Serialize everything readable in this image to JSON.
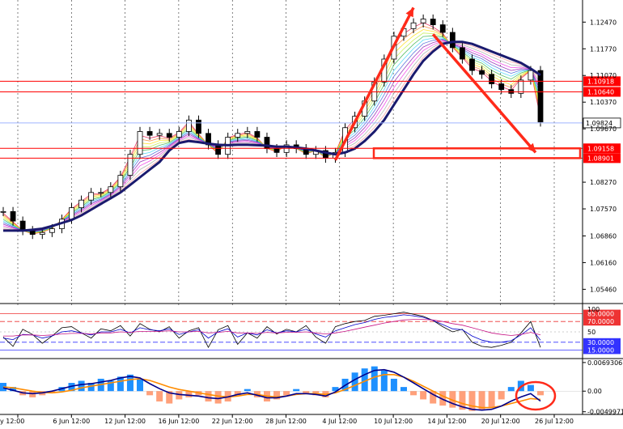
{
  "chart_data": {
    "type": "candlestick",
    "main": {
      "ylim": [
        1.0515,
        1.1305
      ],
      "y_ticks": [
        {
          "v": 1.1247,
          "label": "1.12470"
        },
        {
          "v": 1.1177,
          "label": "1.11770"
        },
        {
          "v": 1.1107,
          "label": "1.11070"
        },
        {
          "v": 1.1037,
          "label": "1.10370"
        },
        {
          "v": 1.0967,
          "label": "1.09670"
        },
        {
          "v": 1.0827,
          "label": "1.08270"
        },
        {
          "v": 1.0757,
          "label": "1.07570"
        },
        {
          "v": 1.0686,
          "label": "1.06860"
        },
        {
          "v": 1.0616,
          "label": "1.06160"
        },
        {
          "v": 1.0546,
          "label": "1.05460"
        }
      ],
      "levels": [
        {
          "v": 1.10918,
          "label": "1.10918",
          "type": "resistance"
        },
        {
          "v": 1.1064,
          "label": "1.10640",
          "type": "resistance"
        },
        {
          "v": 1.09158,
          "label": "1.09158",
          "type": "support"
        },
        {
          "v": 1.08901,
          "label": "1.08901",
          "type": "support"
        }
      ],
      "current_price": {
        "v": 1.09824,
        "label": "1.09824"
      },
      "close": [
        1.075,
        1.0725,
        1.07,
        1.069,
        1.0695,
        1.0705,
        1.073,
        1.076,
        1.078,
        1.08,
        1.08,
        1.0815,
        1.0845,
        1.09,
        1.096,
        1.095,
        1.0955,
        1.0945,
        1.096,
        1.099,
        1.0955,
        1.0925,
        1.09,
        1.0945,
        1.0955,
        1.096,
        1.0945,
        1.0915,
        1.0905,
        1.0925,
        1.0915,
        1.09,
        1.091,
        1.089,
        1.0905,
        1.097,
        1.1,
        1.104,
        1.109,
        1.115,
        1.121,
        1.123,
        1.1245,
        1.1255,
        1.124,
        1.122,
        1.118,
        1.115,
        1.112,
        1.111,
        1.1085,
        1.107,
        1.106,
        1.1095,
        1.112,
        1.0985
      ],
      "ma_long": [
        1.07,
        1.07,
        1.07,
        1.0702,
        1.0705,
        1.0712,
        1.072,
        1.0728,
        1.074,
        1.0755,
        1.077,
        1.0785,
        1.08,
        1.082,
        1.084,
        1.086,
        1.088,
        1.091,
        1.093,
        1.0935,
        1.0932,
        1.0928,
        1.0925,
        1.0924,
        1.0925,
        1.0925,
        1.0924,
        1.0923,
        1.092,
        1.092,
        1.0918,
        1.0915,
        1.091,
        1.0905,
        1.09,
        1.0905,
        1.0915,
        1.0935,
        1.096,
        1.099,
        1.103,
        1.107,
        1.111,
        1.1145,
        1.117,
        1.119,
        1.1195,
        1.1195,
        1.119,
        1.118,
        1.117,
        1.116,
        1.115,
        1.114,
        1.1125,
        1.1108
      ]
    },
    "oscillator": {
      "ylim": [
        0,
        100
      ],
      "levels": [
        {
          "v": 85,
          "label": "85.0000"
        },
        {
          "v": 70,
          "label": "70.0000"
        },
        {
          "v": 30,
          "label": "30.0000"
        },
        {
          "v": 15,
          "label": "15.0000"
        }
      ],
      "tick_labels": [
        "100",
        "50"
      ],
      "series": [
        {
          "values": [
            40,
            22,
            55,
            45,
            28,
            42,
            58,
            60,
            48,
            38,
            56,
            52,
            62,
            42,
            66,
            55,
            50,
            60,
            38,
            52,
            58,
            20,
            54,
            62,
            26,
            48,
            38,
            60,
            46,
            55,
            50,
            62,
            40,
            28,
            60,
            66,
            70,
            72,
            80,
            82,
            85,
            88,
            84,
            80,
            72,
            60,
            50,
            55,
            30,
            22,
            20,
            24,
            30,
            48,
            70,
            20
          ]
        },
        {
          "values": [
            38,
            35,
            45,
            44,
            38,
            42,
            50,
            52,
            48,
            44,
            50,
            50,
            55,
            48,
            58,
            54,
            52,
            56,
            45,
            50,
            54,
            38,
            50,
            56,
            40,
            48,
            44,
            54,
            48,
            52,
            50,
            55,
            46,
            40,
            52,
            58,
            64,
            68,
            74,
            78,
            80,
            83,
            81,
            78,
            72,
            64,
            56,
            54,
            42,
            34,
            30,
            30,
            33,
            44,
            58,
            34
          ]
        },
        {
          "values": [
            42,
            42,
            44,
            44,
            43,
            44,
            46,
            47,
            47,
            46,
            48,
            48,
            50,
            49,
            51,
            51,
            51,
            52,
            50,
            50,
            51,
            48,
            49,
            51,
            48,
            48,
            47,
            49,
            48,
            49,
            49,
            50,
            48,
            46,
            48,
            51,
            55,
            59,
            63,
            67,
            70,
            73,
            74,
            74,
            73,
            70,
            66,
            63,
            58,
            53,
            48,
            45,
            43,
            45,
            49,
            44
          ]
        }
      ]
    },
    "macd": {
      "ylim": [
        -0.00525,
        0.0073
      ],
      "ticks": [
        {
          "v": 0.0069306,
          "label": "0.0069306"
        },
        {
          "v": 0.0,
          "label": "0.00"
        },
        {
          "v": -0.0049971,
          "label": "-0.0049971"
        }
      ],
      "histogram": [
        0.002,
        0.001,
        -0.001,
        -0.0015,
        -0.001,
        -0.0005,
        0.001,
        0.002,
        0.0025,
        0.002,
        0.003,
        0.0025,
        0.0035,
        0.004,
        0.003,
        -0.001,
        -0.0025,
        -0.003,
        -0.002,
        -0.0015,
        -0.001,
        -0.0025,
        -0.003,
        -0.0025,
        -0.001,
        0.0005,
        -0.0015,
        -0.0025,
        -0.002,
        -0.001,
        0.0005,
        -0.0005,
        -0.001,
        -0.0015,
        0.001,
        0.003,
        0.0045,
        0.0055,
        0.006,
        0.005,
        0.003,
        0.001,
        -0.001,
        -0.002,
        -0.003,
        -0.0035,
        -0.004,
        -0.0045,
        -0.0048,
        -0.0045,
        -0.004,
        -0.002,
        0.001,
        0.0025,
        0.0015,
        -0.001
      ],
      "signal": [
        0.001,
        0.0008,
        0.0004,
        0.0,
        -0.0003,
        -0.0004,
        -0.0002,
        0.0002,
        0.0008,
        0.0012,
        0.0016,
        0.002,
        0.0024,
        0.0028,
        0.003,
        0.0026,
        0.0018,
        0.001,
        0.0004,
        0.0,
        -0.0004,
        -0.0008,
        -0.0012,
        -0.0014,
        -0.0012,
        -0.0008,
        -0.0008,
        -0.0012,
        -0.0014,
        -0.0012,
        -0.0008,
        -0.0006,
        -0.0006,
        -0.0008,
        -0.0004,
        0.0004,
        0.0014,
        0.0024,
        0.0034,
        0.004,
        0.004,
        0.0034,
        0.0024,
        0.0012,
        0.0,
        -0.0012,
        -0.0022,
        -0.003,
        -0.0036,
        -0.004,
        -0.004,
        -0.0036,
        -0.003,
        -0.0024,
        -0.0018,
        -0.002
      ],
      "macd_line": [
        0.0008,
        0.0002,
        -0.0004,
        -0.0006,
        -0.0004,
        0.0,
        0.0006,
        0.0012,
        0.0016,
        0.0018,
        0.0022,
        0.0026,
        0.0032,
        0.0036,
        0.0032,
        0.0018,
        0.0006,
        -0.0004,
        -0.0008,
        -0.001,
        -0.0012,
        -0.0016,
        -0.0018,
        -0.0014,
        -0.0008,
        -0.0004,
        -0.001,
        -0.0016,
        -0.0016,
        -0.0012,
        -0.0006,
        -0.0006,
        -0.0008,
        -0.0012,
        -0.0002,
        0.0014,
        0.0028,
        0.004,
        0.005,
        0.0052,
        0.0046,
        0.0034,
        0.002,
        0.0006,
        -0.0008,
        -0.002,
        -0.003,
        -0.0038,
        -0.0044,
        -0.0046,
        -0.0044,
        -0.0036,
        -0.0024,
        -0.0014,
        -0.0006,
        -0.0024
      ]
    },
    "x_ticks": [
      "y 12:00",
      "6 Jun 12:00",
      "12 Jun 12:00",
      "16 Jun 12:00",
      "22 Jun 12:00",
      "28 Jun 12:00",
      "4 Jul 12:00",
      "10 Jul 12:00",
      "14 Jul 12:00",
      "20 Jul 12:00",
      "26 Jul 12:00"
    ],
    "colors": {
      "bull": "#000000",
      "bear": "#000000",
      "ma_long": "#1a1a6e",
      "levels": "#ff0000",
      "arrow": "#ff2a1a",
      "hist_pos": "#1e90ff",
      "hist_neg": "#ffa07a",
      "signal": "#ff8c00",
      "macd_line": "#00008b",
      "osc_a": "#000000",
      "osc_b": "#0000cd",
      "osc_c": "#c71585",
      "current": "#9fb4ff"
    },
    "grid": true
  }
}
